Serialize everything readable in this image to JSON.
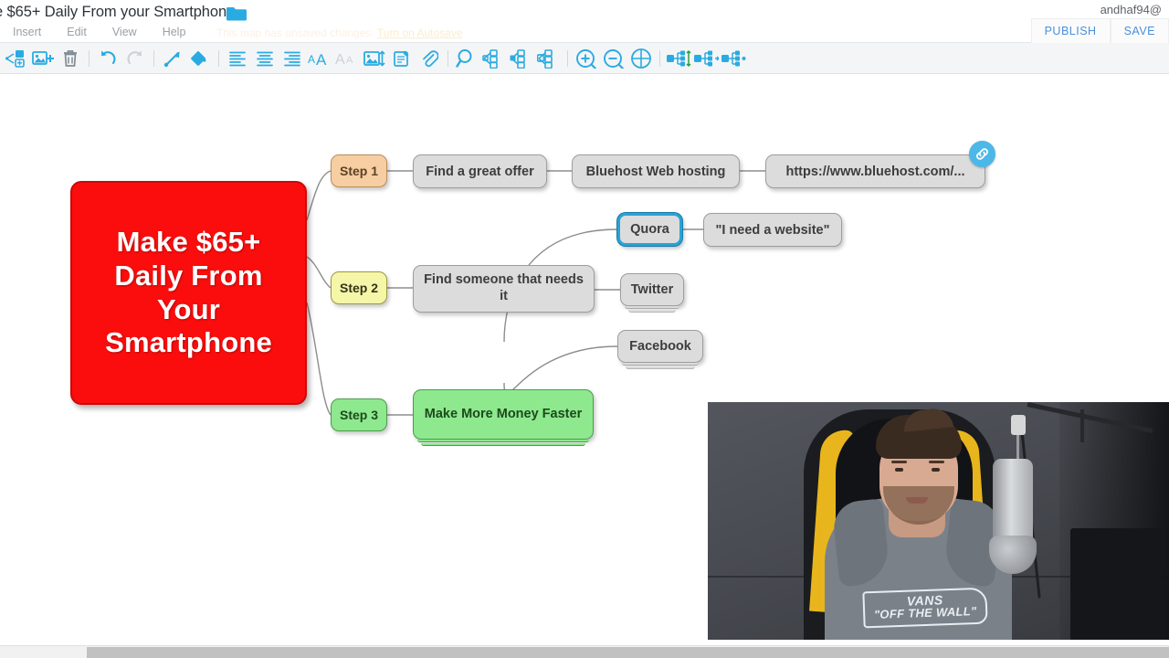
{
  "app": {
    "map_title": "e $65+ Daily From your Smartphone",
    "folder_icon": "folder-icon",
    "account": "andhaf94@"
  },
  "menubar": {
    "items": [
      {
        "label": "Insert",
        "name": "menu-insert"
      },
      {
        "label": "Edit",
        "name": "menu-edit"
      },
      {
        "label": "View",
        "name": "menu-view"
      },
      {
        "label": "Help",
        "name": "menu-help"
      }
    ]
  },
  "status": {
    "unsaved_text": "This map has unsaved changes.",
    "autosave_link": "Turn on Autosave"
  },
  "top_buttons": {
    "publish": "PUBLISH",
    "save": "SAVE"
  },
  "toolbar": {
    "icons": [
      "add-child-node-icon",
      "add-image-icon",
      "delete-node-icon",
      "undo-icon",
      "redo-icon",
      "arrow-connector-icon",
      "fill-color-icon",
      "align-left-icon",
      "align-center-icon",
      "align-right-icon",
      "increase-font-size-icon",
      "decrease-font-size-icon",
      "image-size-icon",
      "add-note-icon",
      "attachment-icon",
      "search-icon",
      "expand-all-icon",
      "collapse-node-icon",
      "collapse-all-icon",
      "zoom-in-icon",
      "zoom-out-icon",
      "zoom-fit-icon",
      "layout-vertical-icon",
      "layout-right-icon",
      "layout-balanced-icon"
    ]
  },
  "mindmap": {
    "root": {
      "text": "Make $65+ Daily From Your Smartphone",
      "color": "#fb0d0d"
    },
    "branches": [
      {
        "step_label": "Step 1",
        "step_color": "#f7cda2",
        "chain": [
          {
            "label": "Find a great offer"
          },
          {
            "label": "Bluehost Web hosting"
          },
          {
            "label": "https://www.bluehost.com/...",
            "has_link": true,
            "link_icon": "link-badge-icon"
          }
        ]
      },
      {
        "step_label": "Step 2",
        "step_color": "#f6f6a9",
        "main": "Find someone that needs it",
        "children": [
          {
            "label": "Quora",
            "selected": true,
            "child": "\"I need a website\""
          },
          {
            "label": "Twitter",
            "collapsed": true
          },
          {
            "label": "Facebook",
            "collapsed": true
          }
        ]
      },
      {
        "step_label": "Step 3",
        "step_color": "#8ee88e",
        "main": "Make More Money Faster",
        "collapsed": true
      }
    ]
  },
  "webcam": {
    "name": "webcam-overlay",
    "hoodie_logo_top": "VANS",
    "hoodie_logo_bottom": "\"OFF THE WALL\""
  },
  "scrollbar": {
    "name": "horizontal-scrollbar"
  }
}
